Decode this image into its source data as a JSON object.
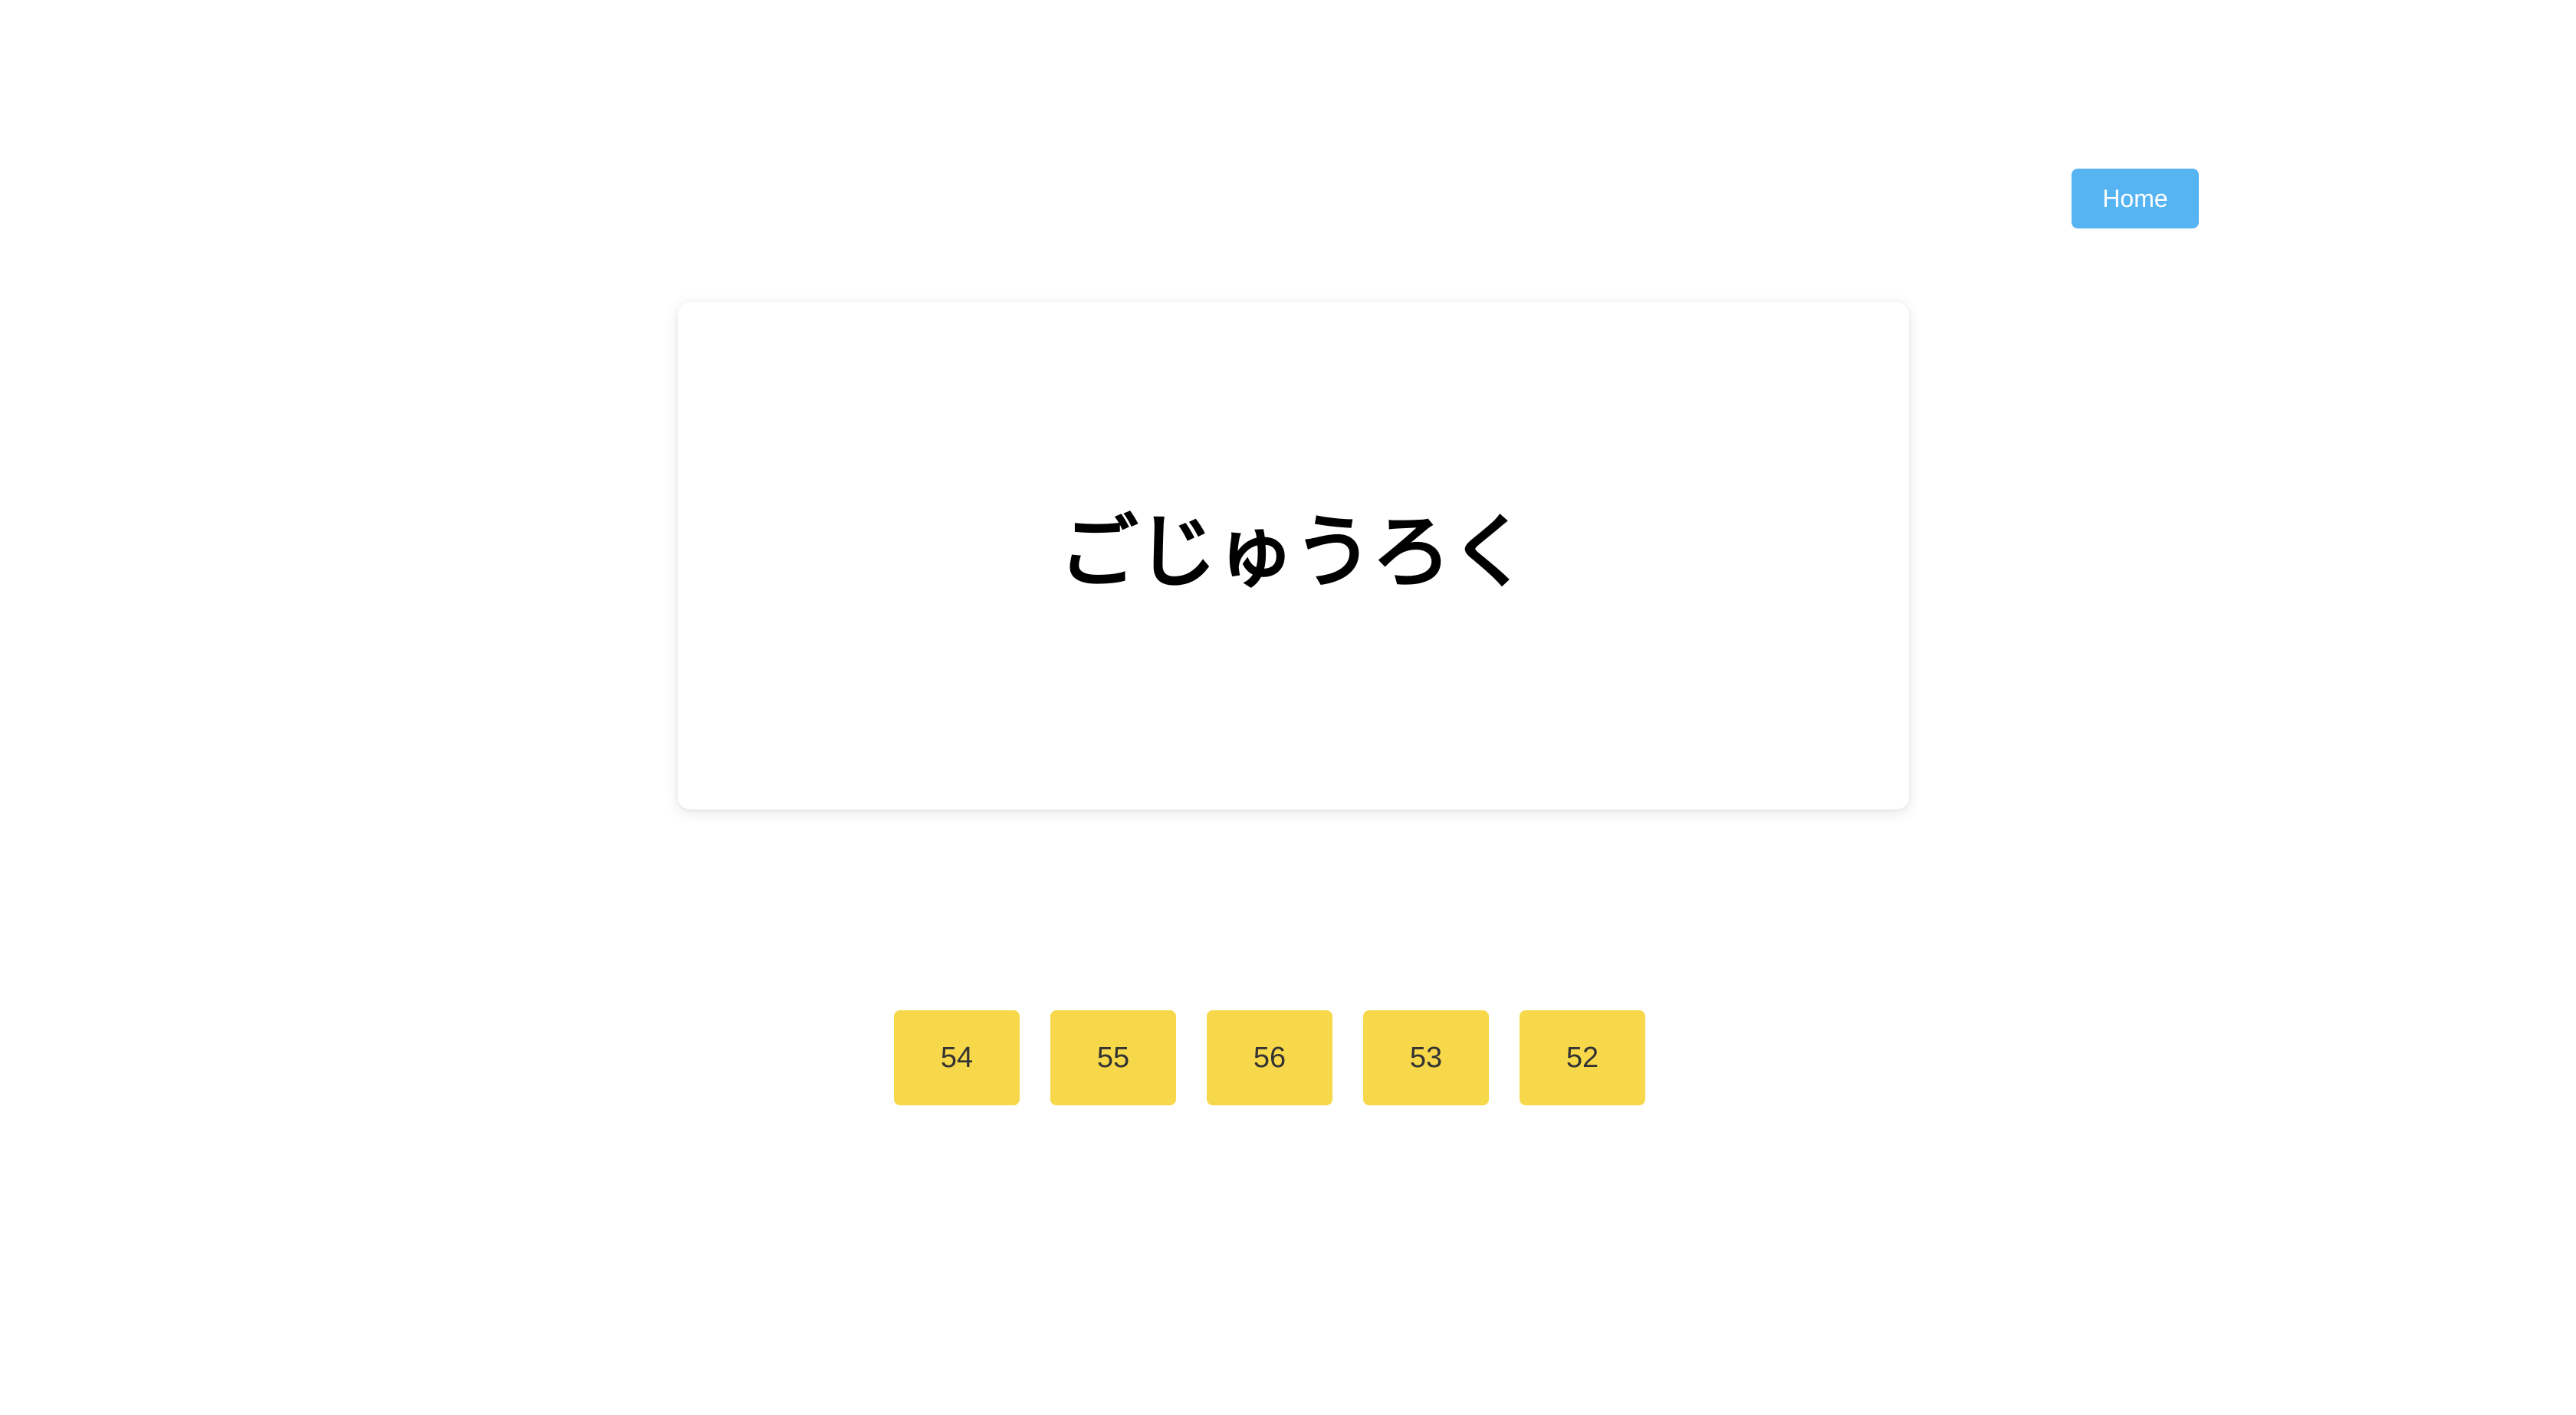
{
  "header": {
    "home_label": "Home"
  },
  "card": {
    "prompt": "ごじゅうろく"
  },
  "answers": [
    "54",
    "55",
    "56",
    "53",
    "52"
  ],
  "colors": {
    "home_button": "#56b4f2",
    "answer_button": "#f7d84a",
    "background": "#ffffff"
  }
}
